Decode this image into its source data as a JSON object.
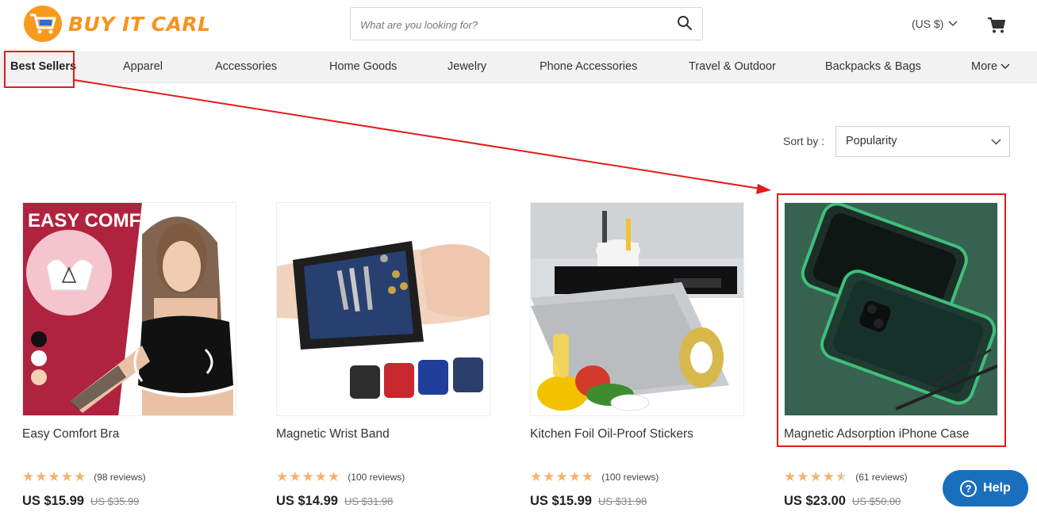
{
  "header": {
    "brand": "BUY IT CARL",
    "search_placeholder": "What are you looking for?",
    "currency": "(US $)"
  },
  "nav": {
    "items": [
      "Best Sellers",
      "Apparel",
      "Accessories",
      "Home Goods",
      "Jewelry",
      "Phone Accessories",
      "Travel & Outdoor",
      "Backpacks & Bags"
    ],
    "more_label": "More"
  },
  "sort": {
    "label": "Sort by :",
    "selected": "Popularity"
  },
  "products": [
    {
      "name": "Easy Comfort Bra",
      "image_caption": "EASY COMFORT BRA",
      "reviews": "(98 reviews)",
      "price": "US $15.99",
      "old_price": "US $35.99",
      "rating": 5
    },
    {
      "name": "Magnetic Wrist Band",
      "reviews": "(100 reviews)",
      "price": "US $14.99",
      "old_price": "US $31.98",
      "rating": 5
    },
    {
      "name": "Kitchen Foil Oil-Proof Stickers",
      "reviews": "(100 reviews)",
      "price": "US $15.99",
      "old_price": "US $31.98",
      "rating": 5
    },
    {
      "name": "Magnetic Adsorption iPhone Case",
      "reviews": "(61 reviews)",
      "price": "US $23.00",
      "old_price": "US $50.00",
      "rating": 4.5
    }
  ],
  "help_label": "Help",
  "colors": {
    "brand_orange": "#f7931e",
    "annotation_red": "#e31b1b",
    "star": "#f6b26b",
    "help_blue": "#1a6fbd"
  }
}
